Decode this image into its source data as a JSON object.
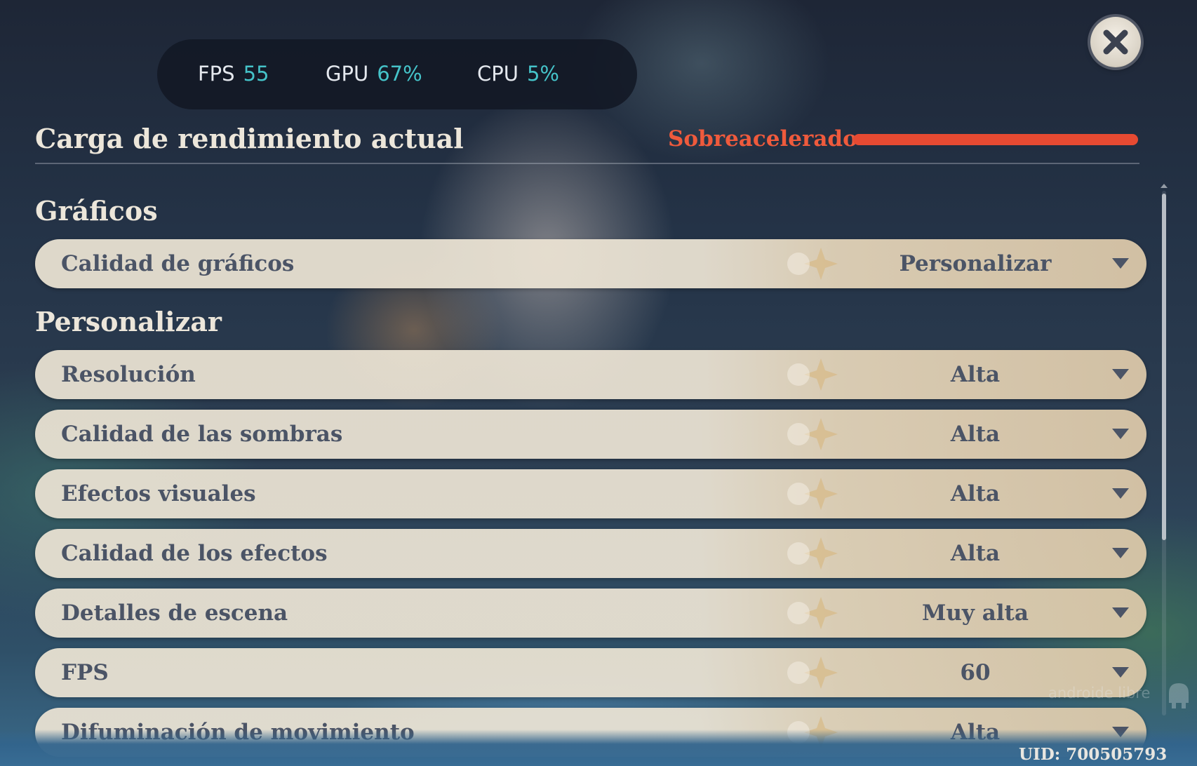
{
  "stats": {
    "fps_label": "FPS",
    "fps_value": "55",
    "gpu_label": "GPU",
    "gpu_value": "67%",
    "cpu_label": "CPU",
    "cpu_value": "5%"
  },
  "performance": {
    "title": "Carga de rendimiento actual",
    "status": "Sobreacelerado",
    "load_level": 1.0,
    "status_color": "#e74a32"
  },
  "sections": {
    "graphics_title": "Gráficos",
    "custom_title": "Personalizar"
  },
  "graphics_quality": {
    "label": "Calidad de gráficos",
    "value": "Personalizar"
  },
  "settings": [
    {
      "label": "Resolución",
      "value": "Alta"
    },
    {
      "label": "Calidad de las sombras",
      "value": "Alta"
    },
    {
      "label": "Efectos visuales",
      "value": "Alta"
    },
    {
      "label": "Calidad de los efectos",
      "value": "Alta"
    },
    {
      "label": "Detalles de escena",
      "value": "Muy alta"
    },
    {
      "label": "FPS",
      "value": "60"
    },
    {
      "label": "Difuminación de movimiento",
      "value": "Alta"
    }
  ],
  "footer": {
    "uid": "UID: 700505793",
    "watermark": "androide libre"
  },
  "icons": {
    "close": "close-icon",
    "dropdown": "chevron-down-icon"
  },
  "colors": {
    "accent_cyan": "#45c3c9",
    "status_red": "#ef5a3c",
    "row_text": "#4b5466",
    "title_text": "#ece6da"
  }
}
